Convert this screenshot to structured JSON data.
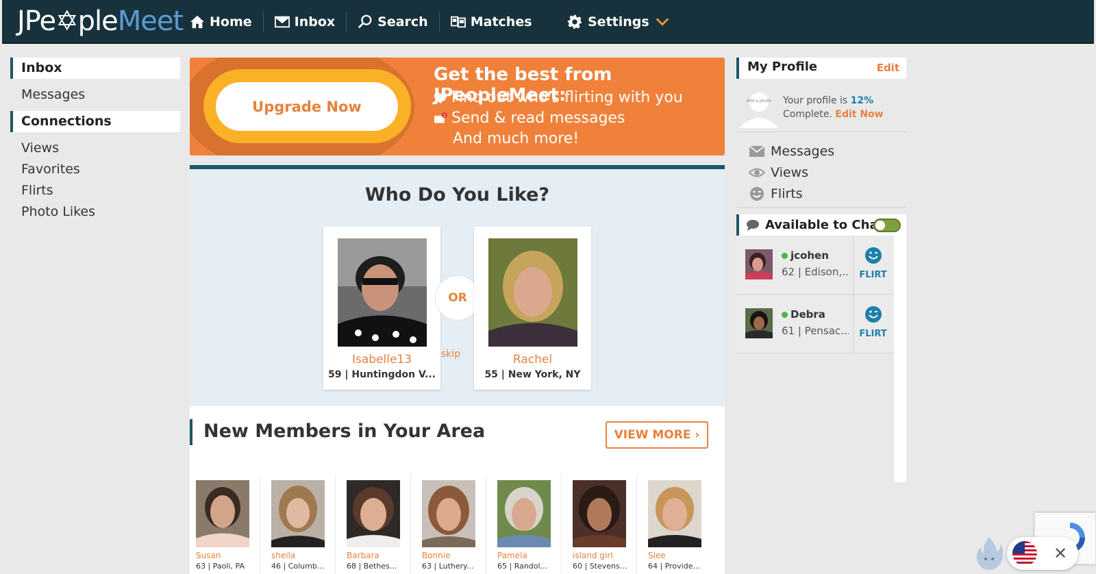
{
  "brand": {
    "logo_part1": "JPe",
    "logo_part2": "ple",
    "logo_part3": "Meet"
  },
  "nav": {
    "home": "Home",
    "inbox": "Inbox",
    "search": "Search",
    "matches": "Matches",
    "settings": "Settings"
  },
  "sidebar": {
    "inbox_header": "Inbox",
    "messages": "Messages",
    "connections_header": "Connections",
    "views": "Views",
    "favorites": "Favorites",
    "flirts": "Flirts",
    "photo_likes": "Photo Likes"
  },
  "banner": {
    "button": "Upgrade Now",
    "title": "Get the best from JPeopleMeet:",
    "line1": "Find out who's flirting with you",
    "line2": "Send & read messages",
    "line3": "And much more!",
    "badge": "2"
  },
  "who_do_you_like": {
    "title": "Who Do You Like?",
    "or_label": "OR",
    "skip_label": "skip",
    "left": {
      "name": "Isabelle13",
      "meta": "59 | Huntingdon V..."
    },
    "right": {
      "name": "Rachel",
      "meta": "55 | New York, NY"
    }
  },
  "new_members": {
    "title": "New Members in Your Area",
    "view_more": "VIEW MORE",
    "members": [
      {
        "name": "Susan",
        "meta": "63 | Paoli, PA"
      },
      {
        "name": "sheila",
        "meta": "46 | Columb..."
      },
      {
        "name": "Barbara",
        "meta": "68 | Bethes..."
      },
      {
        "name": "Bonnie",
        "meta": "63 | Luthery..."
      },
      {
        "name": "Pamela",
        "meta": "65 | Randol..."
      },
      {
        "name": "island girl",
        "meta": "60 | Stevens..."
      },
      {
        "name": "Slee",
        "meta": "64 | Provide..."
      }
    ]
  },
  "my_profile": {
    "title": "My Profile",
    "edit": "Edit",
    "add_photo": "Add a photo",
    "complete_prefix": "Your profile is ",
    "complete_pct": "12%",
    "complete_suffix": "Complete.",
    "edit_now": "Edit Now",
    "links": [
      "Messages",
      "Views",
      "Flirts"
    ]
  },
  "chat": {
    "title": "Available to Chat",
    "users": [
      {
        "name": "jcohen",
        "meta": "62 | Edison,...",
        "flirt": "FLIRT"
      },
      {
        "name": "Debra",
        "meta": "61 | Pensac...",
        "flirt": "FLIRT"
      }
    ]
  },
  "colors": {
    "nav_bg": "#17323c",
    "accent": "#e7813d",
    "banner": "#f0813a",
    "teal": "#1c5667",
    "link_blue": "#1e7faa"
  }
}
